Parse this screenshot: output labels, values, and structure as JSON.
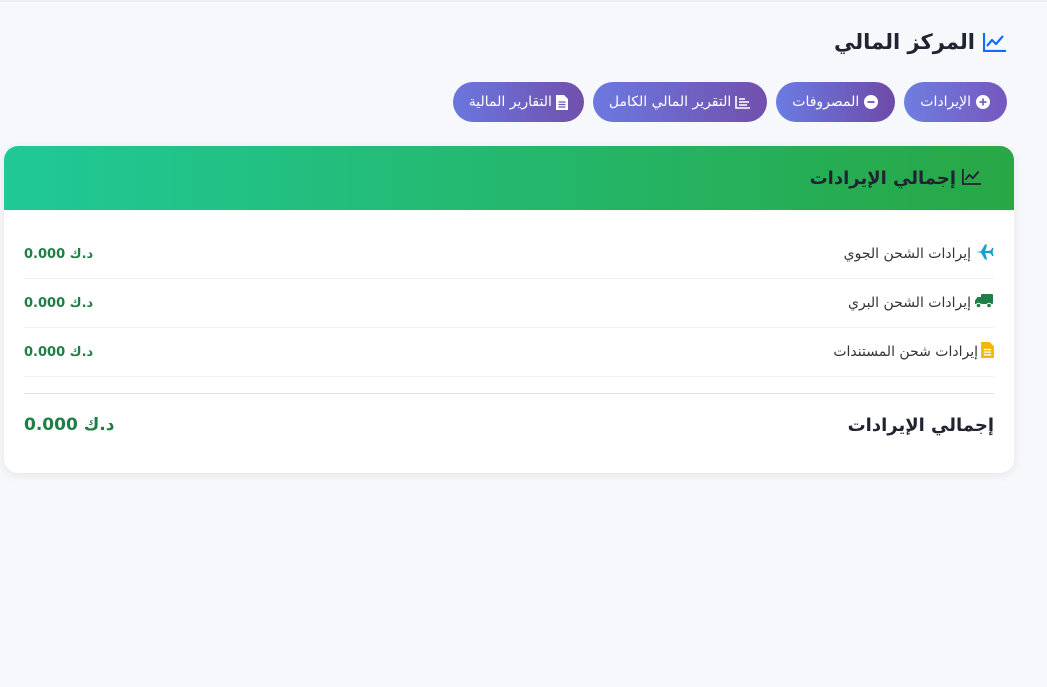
{
  "header": {
    "title": "المركز المالي",
    "icon": "chart-line-icon"
  },
  "actions": [
    {
      "label": "الإيرادات",
      "icon": "plus-circle-icon"
    },
    {
      "label": "المصروفات",
      "icon": "minus-circle-icon"
    },
    {
      "label": "التقرير المالي الكامل",
      "icon": "list-icon"
    },
    {
      "label": "التقارير المالية",
      "icon": "file-icon"
    }
  ],
  "card": {
    "title": "إجمالي الإيرادات",
    "icon": "chart-line-icon",
    "rows": [
      {
        "label": "إيرادات الشحن الجوي",
        "value": "0.000 د.ك",
        "icon": "plane-icon",
        "icon_color": "#17a2c8"
      },
      {
        "label": "إيرادات الشحن البري",
        "value": "0.000 د.ك",
        "icon": "truck-icon",
        "icon_color": "#1e7e45"
      },
      {
        "label": "إيرادات شحن المستندات",
        "value": "0.000 د.ك",
        "icon": "document-icon",
        "icon_color": "#f2b705"
      }
    ],
    "total_label": "إجمالي الإيرادات",
    "total_value": "0.000 د.ك"
  },
  "colors": {
    "accent": "#0d6efd",
    "value_green": "#1e7e45",
    "header_green_start": "#28a745",
    "header_green_end": "#20c997"
  }
}
